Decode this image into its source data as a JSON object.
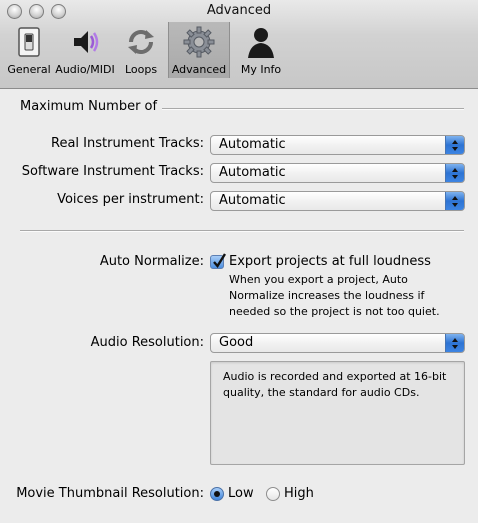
{
  "window": {
    "title": "Advanced"
  },
  "toolbar": {
    "items": [
      {
        "label": "General",
        "icon": "switch-icon"
      },
      {
        "label": "Audio/MIDI",
        "icon": "speaker-icon"
      },
      {
        "label": "Loops",
        "icon": "loop-arrows-icon"
      },
      {
        "label": "Advanced",
        "icon": "gear-icon",
        "selected": true
      },
      {
        "label": "My Info",
        "icon": "person-icon"
      }
    ]
  },
  "max_tracks": {
    "heading": "Maximum Number of",
    "real_label": "Real Instrument Tracks:",
    "real_value": "Automatic",
    "software_label": "Software Instrument Tracks:",
    "software_value": "Automatic",
    "voices_label": "Voices per instrument:",
    "voices_value": "Automatic"
  },
  "auto_normalize": {
    "label": "Auto Normalize:",
    "checkbox_label": "Export projects at full loudness",
    "checked": true,
    "note_lines": [
      "When you export a project, Auto",
      "Normalize increases the loudness if",
      "needed so the project is not too quiet."
    ]
  },
  "audio_resolution": {
    "label": "Audio Resolution:",
    "value": "Good",
    "info_lines": [
      "Audio is recorded and exported at 16-bit",
      "quality, the standard for audio CDs."
    ]
  },
  "movie_thumbnail": {
    "label": "Movie Thumbnail Resolution:",
    "options": [
      "Low",
      "High"
    ],
    "selected": "Low"
  },
  "colors": {
    "accent": "#3d84e2",
    "window_bg": "#ececec"
  }
}
